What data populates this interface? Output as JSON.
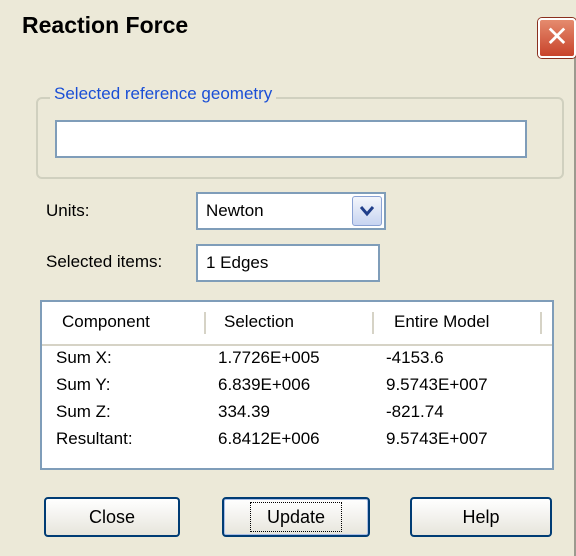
{
  "window": {
    "title": "Reaction Force"
  },
  "icons": {
    "close": "close-icon",
    "dropdown": "chevron-down-icon"
  },
  "reference": {
    "label": "Selected reference geometry",
    "value": ""
  },
  "units": {
    "label": "Units:",
    "value": "Newton"
  },
  "selected_items": {
    "label": "Selected items:",
    "value": "1 Edges"
  },
  "table": {
    "headers": [
      "Component",
      "Selection",
      "Entire Model"
    ],
    "rows": [
      [
        "Sum X:",
        "1.7726E+005",
        "-4153.6"
      ],
      [
        "Sum Y:",
        "6.839E+006",
        "9.5743E+007"
      ],
      [
        "Sum Z:",
        "334.39",
        "-821.74"
      ],
      [
        "Resultant:",
        "6.8412E+006",
        "9.5743E+007"
      ]
    ]
  },
  "buttons": {
    "close": "Close",
    "update": "Update",
    "help": "Help"
  },
  "colors": {
    "accent": "#1a4fd6",
    "close_red": "#c8432b",
    "dialog_bg": "#ECE9D8"
  }
}
